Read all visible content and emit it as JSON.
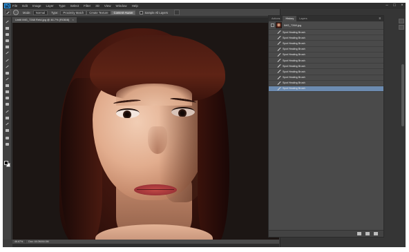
{
  "app": {
    "logo": "Ps",
    "menu": [
      "File",
      "Edit",
      "Image",
      "Layer",
      "Type",
      "Select",
      "Filter",
      "3D",
      "View",
      "Window",
      "Help"
    ],
    "window_controls": [
      "–",
      "□",
      "×"
    ]
  },
  "options_bar": {
    "mode_label": "Mode:",
    "mode_value": "Normal",
    "type_label": "Type:",
    "type_options": [
      "Proximity Match",
      "Create Texture",
      "Content-Aware"
    ],
    "type_selected": "Content-Aware",
    "sample_all_layers_label": "Sample All Layers"
  },
  "document": {
    "tab_label": "Untitl IMG_7268 Retd.jpg @ 46.7% (RGB/8)",
    "close_glyph": "×",
    "zoom": "46.67%",
    "doc_size": "Doc: 44.0M/44.0M"
  },
  "history_panel": {
    "tabs": [
      "Actions",
      "History",
      "Layers"
    ],
    "active_tab": "History",
    "menu_glyph": "≡",
    "snapshot_label": "IMG_7268.jpg",
    "items": [
      {
        "label": "Spot Healing Brush",
        "selected": false
      },
      {
        "label": "Spot Healing Brush",
        "selected": false
      },
      {
        "label": "Spot Healing Brush",
        "selected": false
      },
      {
        "label": "Spot Healing Brush",
        "selected": false
      },
      {
        "label": "Spot Healing Brush",
        "selected": false
      },
      {
        "label": "Spot Healing Brush",
        "selected": false
      },
      {
        "label": "Spot Healing Brush",
        "selected": false
      },
      {
        "label": "Spot Healing Brush",
        "selected": false
      },
      {
        "label": "Spot Healing Brush",
        "selected": false
      },
      {
        "label": "Spot Healing Brush",
        "selected": false
      },
      {
        "label": "Spot Healing Brush",
        "selected": true
      }
    ],
    "selection_color": "#6c8bb0"
  },
  "icons": {
    "toolbox": [
      "move-icon",
      "marquee-icon",
      "lasso-icon",
      "quick-select-icon",
      "crop-icon",
      "eyedropper-icon",
      "spot-healing-icon",
      "brush-icon",
      "clone-stamp-icon",
      "history-brush-icon",
      "eraser-icon",
      "gradient-icon",
      "blur-icon",
      "dodge-icon",
      "pen-icon",
      "type-icon",
      "path-select-icon",
      "shape-icon",
      "hand-icon",
      "zoom-icon"
    ],
    "panel_footer": [
      "new-document-icon",
      "camera-icon",
      "trash-icon"
    ]
  }
}
